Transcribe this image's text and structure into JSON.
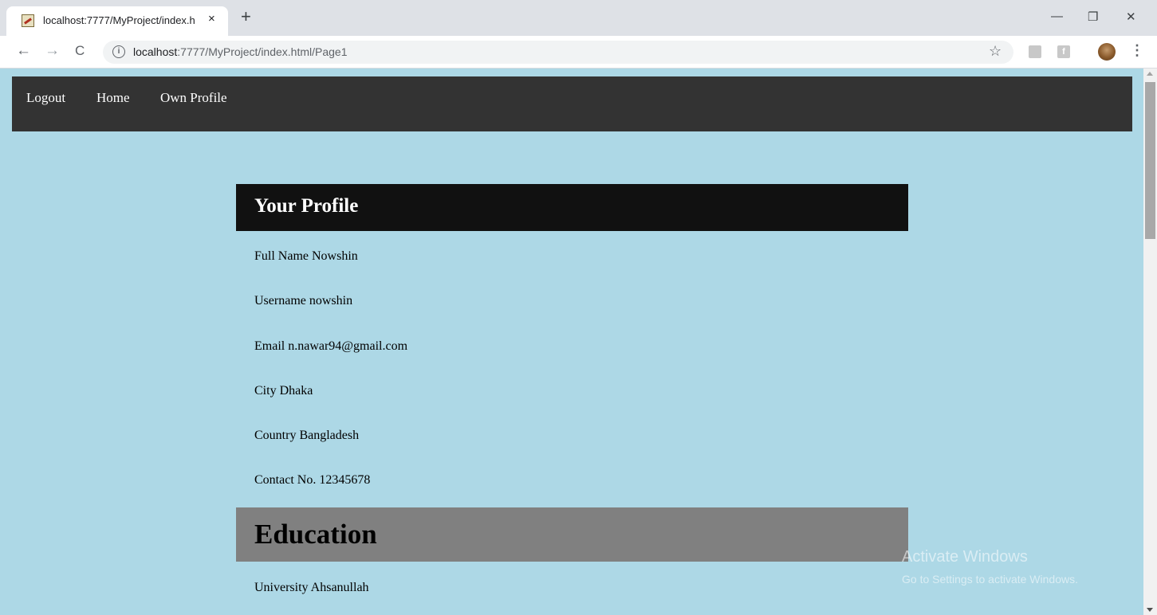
{
  "browser": {
    "tab_title": "localhost:7777/MyProject/index.h",
    "tab_close": "×",
    "new_tab": "+",
    "minimize": "—",
    "restore": "❐",
    "close": "✕",
    "back": "←",
    "forward": "→",
    "reload": "C",
    "url_host": "localhost",
    "url_path": ":7777/MyProject/index.html/Page1",
    "star": "☆",
    "menu": "⋮",
    "icons": {
      "favicon": "page-favicon-icon",
      "info": "info-icon",
      "star": "bookmark-star-icon",
      "ext1": "pdf-extension-icon",
      "ext2": "facebook-extension-icon",
      "profile": "profile-avatar"
    }
  },
  "nav": {
    "items": [
      {
        "label": "Logout"
      },
      {
        "label": "Home"
      },
      {
        "label": "Own Profile"
      }
    ]
  },
  "profile": {
    "title": "Your Profile",
    "fields": [
      {
        "text": "Full Name Nowshin"
      },
      {
        "text": "Username nowshin"
      },
      {
        "text": "Email n.nawar94@gmail.com"
      },
      {
        "text": "City Dhaka"
      },
      {
        "text": "Country Bangladesh"
      },
      {
        "text": "Contact No. 12345678"
      }
    ]
  },
  "education": {
    "title": "Education",
    "fields": [
      {
        "text": "University Ahsanullah"
      }
    ]
  },
  "watermark": {
    "title": "Activate Windows",
    "subtitle": "Go to Settings to activate Windows."
  },
  "colors": {
    "page_bg": "#add8e6",
    "nav_bg": "#333333",
    "profile_header_bg": "#111111",
    "education_header_bg": "#808080"
  }
}
